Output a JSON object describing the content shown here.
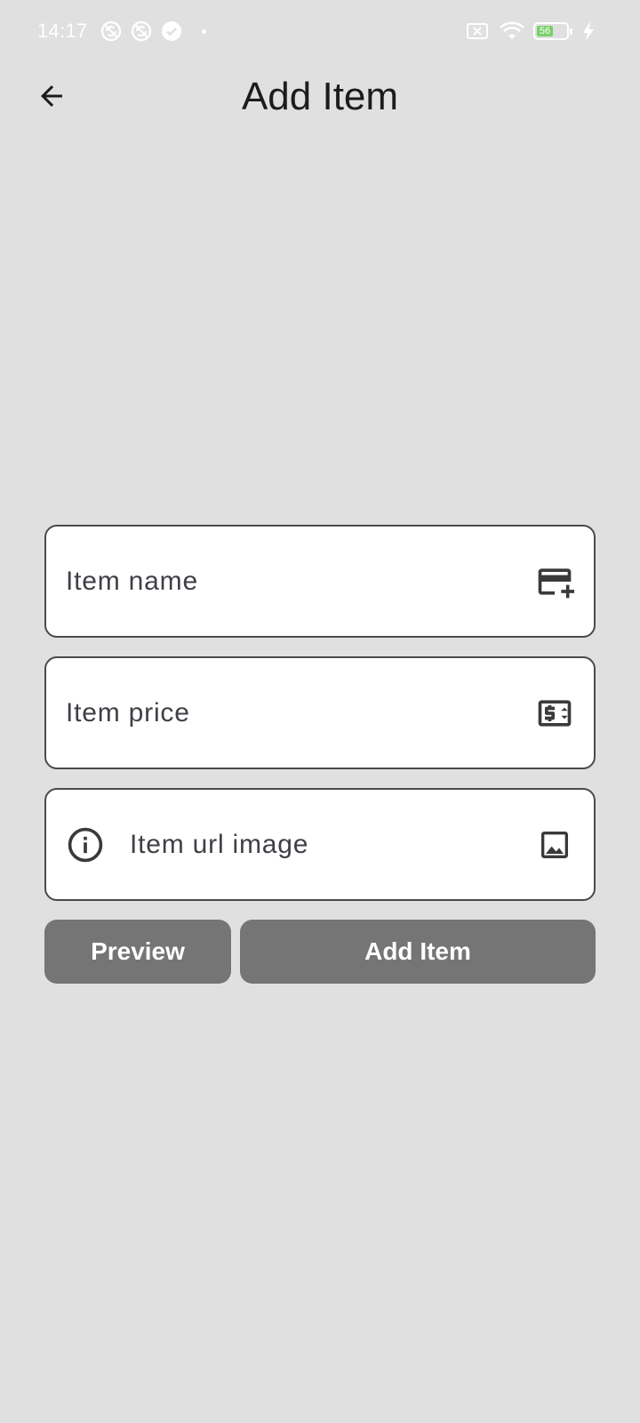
{
  "status_bar": {
    "time": "14:17",
    "battery_level": "56",
    "battery_color": "#7bd068"
  },
  "app_bar": {
    "title": "Add Item",
    "back_icon": "arrow-left-icon"
  },
  "form": {
    "item_name": {
      "placeholder": "Item name",
      "value": "",
      "trailing_icon": "credit-card-add-icon"
    },
    "item_price": {
      "placeholder": "Item price",
      "value": "",
      "trailing_icon": "price-change-icon"
    },
    "item_url_image": {
      "placeholder": "Item url image",
      "value": "",
      "leading_icon": "info-icon",
      "trailing_icon": "image-icon"
    }
  },
  "actions": {
    "preview_label": "Preview",
    "add_item_label": "Add Item",
    "button_color": "#757575"
  },
  "colors": {
    "background": "#e0e0e0",
    "field_border": "#4a4a4a",
    "title_text": "#1c1c1c"
  }
}
